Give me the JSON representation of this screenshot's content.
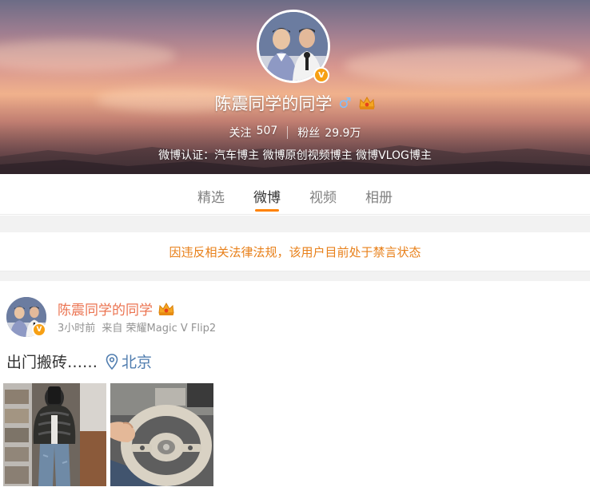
{
  "profile": {
    "name": "陈震同学的同学",
    "gender_symbol": "♂",
    "verified_symbol": "V",
    "stats": [
      {
        "label": "关注",
        "value": "507"
      },
      {
        "label": "粉丝",
        "value": "29.9万"
      }
    ],
    "verification": "微博认证：汽车博主 微博原创视频博主 微博VLOG博主"
  },
  "tabs": [
    {
      "label": "精选",
      "active": false
    },
    {
      "label": "微博",
      "active": true
    },
    {
      "label": "视频",
      "active": false
    },
    {
      "label": "相册",
      "active": false
    }
  ],
  "notice": "因违反相关法律法规，该用户目前处于禁言状态",
  "post": {
    "author": "陈震同学的同学",
    "time": "3小时前",
    "source": "来自 荣耀Magic V Flip2",
    "text": "出门搬砖……",
    "location": "北京"
  },
  "colors": {
    "accent_orange": "#ff8200",
    "notice_orange": "#e8801a",
    "author_name": "#eb7350",
    "location_blue": "#507daf",
    "verified_gold": "#f7a014"
  },
  "icons": [
    "gender-male-icon",
    "crown-member-icon",
    "verified-v-icon",
    "location-pin-icon"
  ]
}
